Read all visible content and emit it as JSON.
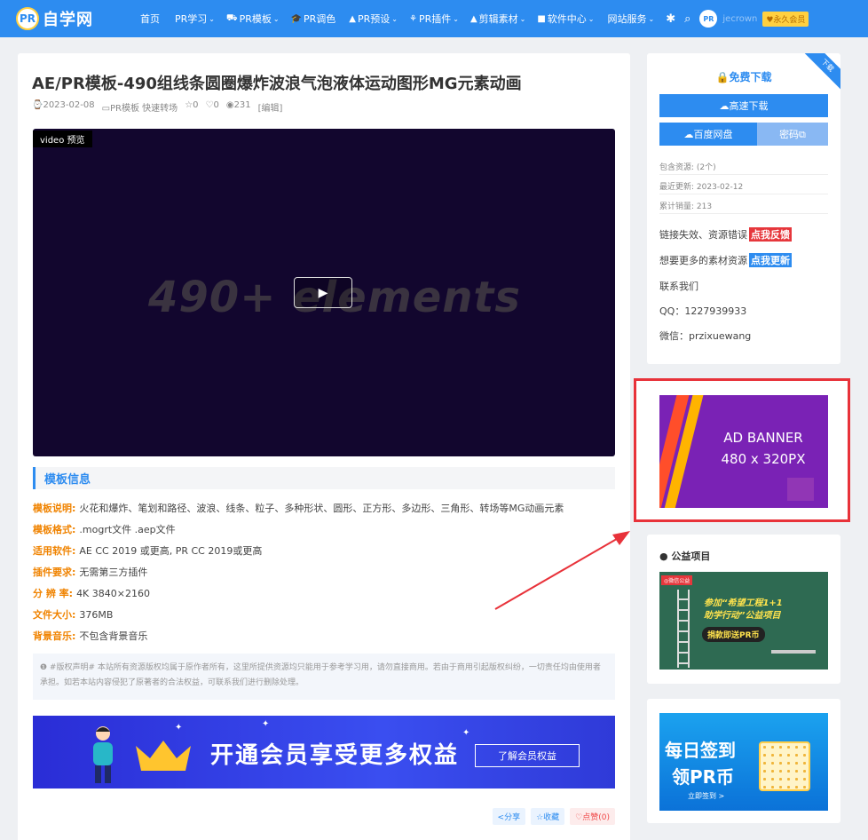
{
  "nav": {
    "logo_badge": "PR",
    "logo_text": "自学网",
    "items": [
      {
        "label": "首页",
        "icon": "",
        "caret": ""
      },
      {
        "label": "PR学习",
        "icon": "",
        "caret": "⌄"
      },
      {
        "label": "PR模板",
        "icon": "⛟",
        "caret": "⌄"
      },
      {
        "label": "PR调色",
        "icon": "🎓",
        "caret": ""
      },
      {
        "label": "PR预设",
        "icon": "▲",
        "caret": "⌄"
      },
      {
        "label": "PR插件",
        "icon": "⚘",
        "caret": "⌄"
      },
      {
        "label": "剪辑素材",
        "icon": "▲",
        "caret": "⌄"
      },
      {
        "label": "软件中心",
        "icon": "■",
        "caret": "⌄"
      },
      {
        "label": "网站服务",
        "icon": "",
        "caret": "⌄"
      }
    ],
    "username": "jecrown",
    "vip_label": "♥永久会员"
  },
  "post": {
    "title": "AE/PR模板-490组线条圆圈爆炸波浪气泡液体运动图形MG元素动画",
    "date": "⌚2023-02-08",
    "category": "▭PR模板 快速转场",
    "favorites": "☆0",
    "likes": "♡0",
    "views": "◉231",
    "edit": "[编辑]"
  },
  "video": {
    "tag": "video 预览",
    "bigtext": "490+ elements"
  },
  "info": {
    "heading": "模板信息",
    "rows": [
      {
        "key": "模板说明:",
        "val": "火花和爆炸、笔划和路径、波浪、线条、粒子、多种形状、圆形、正方形、多边形、三角形、转场等MG动画元素"
      },
      {
        "key": "模板格式:",
        "val": ".mogrt文件 .aep文件"
      },
      {
        "key": "适用软件:",
        "val": "AE CC 2019 或更高, PR CC 2019或更高"
      },
      {
        "key": "插件要求:",
        "val": "无需第三方插件"
      },
      {
        "key": "分 辨 率:",
        "val": "4K 3840×2160"
      },
      {
        "key": "文件大小:",
        "val": "376MB"
      },
      {
        "key": "背景音乐:",
        "val": "不包含背景音乐"
      }
    ]
  },
  "disclaimer": "❶ #版权声明# 本站所有资源版权均属于原作者所有，这里所提供资源均只能用于参考学习用，请勿直接商用。若由于商用引起版权纠纷，一切责任均由使用者承担。如若本站内容侵犯了原著者的合法权益，可联系我们进行删除处理。",
  "vip_banner": {
    "text": "开通会员享受更多权益",
    "link": "了解会员权益"
  },
  "actions": {
    "share": "<分享",
    "fav": "☆收藏",
    "like": "♡点赞(0)"
  },
  "sidebar": {
    "corner": "下载",
    "free_download": "🔒免费下载",
    "fast_download": "☁高速下载",
    "baidu": "☁百度网盘",
    "password": "密码⧉",
    "meta": [
      "包含资源: (2个)",
      "最近更新: 2023-02-12",
      "累计销量: 213"
    ],
    "feedback_text": "链接失效、资源错误",
    "feedback_link": "点我反馈",
    "more_text": "想要更多的素材资源",
    "more_link": "点我更新",
    "contact": "联系我们",
    "qq": "QQ：1227939933",
    "wechat": "微信：przixuewang"
  },
  "ad": {
    "line1": "AD BANNER",
    "line2": "480 x 320PX"
  },
  "charity": {
    "title": "● 公益项目",
    "tag": "◎微信公益",
    "line1": "参加“希望工程1+1",
    "line2": "助学行动”公益项目",
    "cta": "捐款即送PR币"
  },
  "checkin": {
    "line1": "每日签到",
    "line2": "领PR币",
    "line3": "立即签到 >"
  },
  "colors": {
    "brand": "#2d8cf0",
    "accent_orange": "#f08300",
    "highlight_red": "#e8323a"
  }
}
